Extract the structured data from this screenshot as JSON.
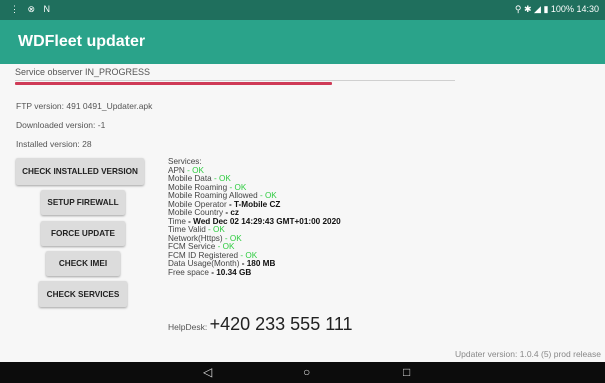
{
  "status_bar": {
    "left_icons": "⋮ ⊗ N",
    "right_text": "100%",
    "time": "14:30"
  },
  "app": {
    "title": "WDFleet updater"
  },
  "observer": {
    "text": "Service observer IN_PROGRESS",
    "progress": 0.72
  },
  "info": {
    "ftp": "FTP version: 491 0491_Updater.apk",
    "downloaded": "Downloaded version: -1",
    "installed": "Installed version: 28"
  },
  "buttons": {
    "check_installed": "CHECK INSTALLED VERSION",
    "setup_firewall": "SETUP FIREWALL",
    "force_update": "FORCE UPDATE",
    "check_imei": "CHECK IMEI",
    "check_services": "CHECK SERVICES"
  },
  "services": {
    "header": "Services:",
    "rows": [
      {
        "name": "APN",
        "value": "- OK",
        "style": "ok"
      },
      {
        "name": "Mobile Data",
        "value": "- OK",
        "style": "ok"
      },
      {
        "name": "Mobile Roaming",
        "value": "- OK",
        "style": "ok"
      },
      {
        "name": "Mobile Roaming Allowed",
        "value": "- OK",
        "style": "ok"
      },
      {
        "name": "Mobile Operator",
        "value": "- T-Mobile CZ",
        "style": "bold"
      },
      {
        "name": "Mobile Country",
        "value": "- cz",
        "style": "bold"
      },
      {
        "name": "Time",
        "value": "- Wed Dec 02 14:29:43 GMT+01:00 2020",
        "style": "bold"
      },
      {
        "name": "Time Valid",
        "value": "- OK",
        "style": "ok"
      },
      {
        "name": "Network(Https)",
        "value": "- OK",
        "style": "ok"
      },
      {
        "name": "FCM Service",
        "value": "- OK",
        "style": "ok"
      },
      {
        "name": "FCM ID Registered",
        "value": "- OK",
        "style": "ok"
      },
      {
        "name": "Data Usage(Month)",
        "value": "- 180 MB",
        "style": "bold"
      },
      {
        "name": "Free space",
        "value": "- 10.34 GB",
        "style": "bold"
      }
    ]
  },
  "helpdesk": {
    "label": "HelpDesk:",
    "phone": "+420 233 555 111"
  },
  "footer": {
    "version": "Updater version: 1.0.4 (5) prod release"
  },
  "nav": {
    "back": "◁",
    "home": "○",
    "recents": "□"
  }
}
